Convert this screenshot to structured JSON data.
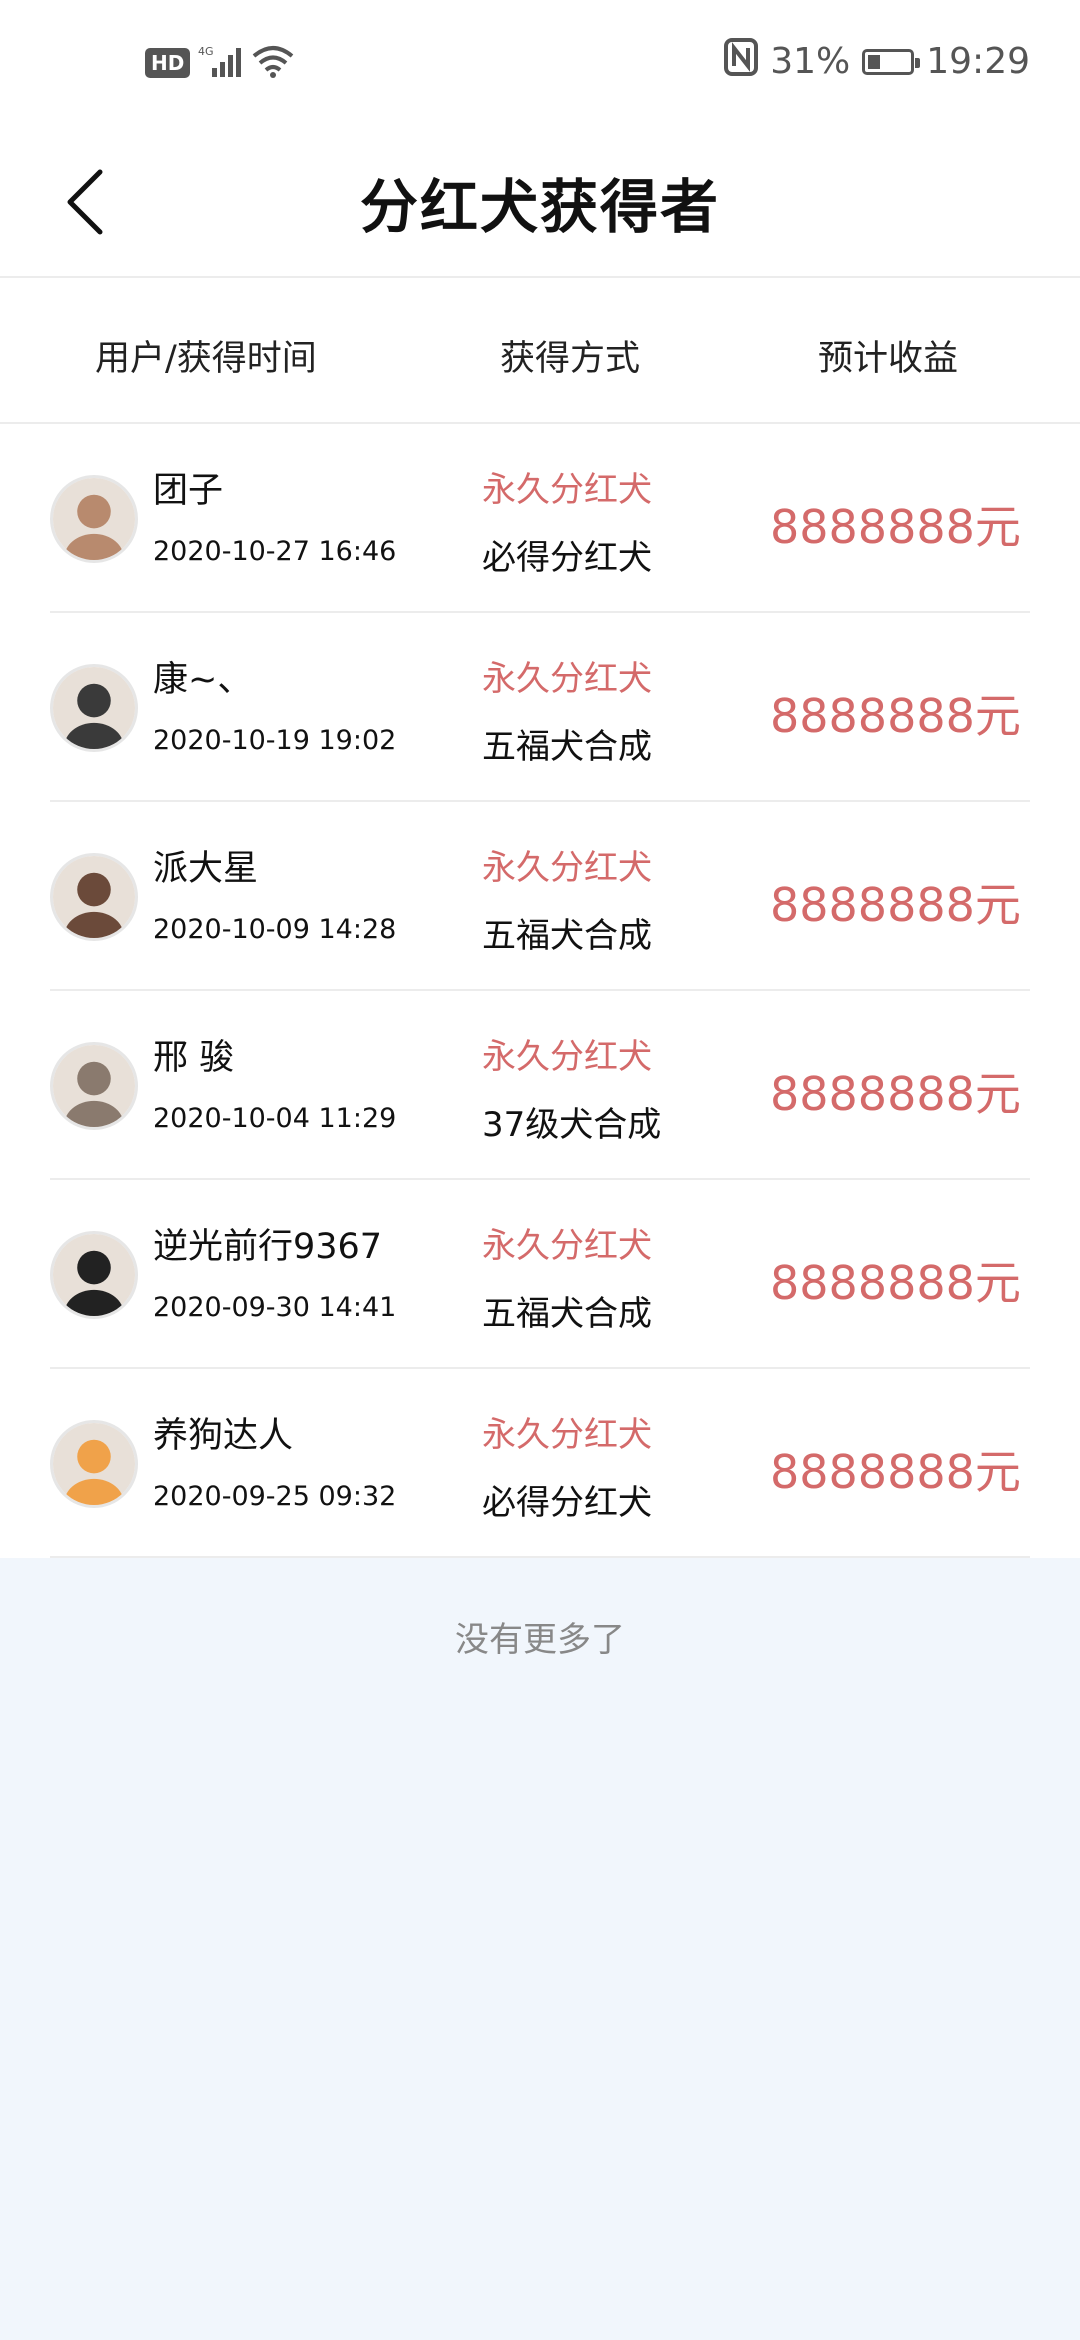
{
  "status_bar": {
    "hd_label": "HD",
    "network_label": "4G",
    "battery_percent": "31%",
    "battery_level": 0.31,
    "time": "19:29"
  },
  "header": {
    "title": "分红犬获得者",
    "back_icon": "chevron-left-icon"
  },
  "columns": {
    "user": "用户/获得时间",
    "method": "获得方式",
    "earnings": "预计收益"
  },
  "rows": [
    {
      "name": "团子",
      "time": "2020-10-27 16:46",
      "method_type": "永久分红犬",
      "method_source": "必得分红犬",
      "earnings": "8888888元",
      "avatar_color": "#b88a6e"
    },
    {
      "name": "康~、",
      "time": "2020-10-19 19:02",
      "method_type": "永久分红犬",
      "method_source": "五福犬合成",
      "earnings": "8888888元",
      "avatar_color": "#3a3a3a"
    },
    {
      "name": "派大星",
      "time": "2020-10-09 14:28",
      "method_type": "永久分红犬",
      "method_source": "五福犬合成",
      "earnings": "8888888元",
      "avatar_color": "#6b4a3a"
    },
    {
      "name": "邢  骏",
      "time": "2020-10-04 11:29",
      "method_type": "永久分红犬",
      "method_source": "37级犬合成",
      "earnings": "8888888元",
      "avatar_color": "#8a7a6e"
    },
    {
      "name": "逆光前行9367",
      "time": "2020-09-30 14:41",
      "method_type": "永久分红犬",
      "method_source": "五福犬合成",
      "earnings": "8888888元",
      "avatar_color": "#222222"
    },
    {
      "name": "养狗达人",
      "time": "2020-09-25 09:32",
      "method_type": "永久分红犬",
      "method_source": "必得分红犬",
      "earnings": "8888888元",
      "avatar_color": "#f0a24a"
    }
  ],
  "footer": {
    "no_more": "没有更多了"
  },
  "colors": {
    "accent": "#d46a6a",
    "background": "#f1f6fc"
  }
}
